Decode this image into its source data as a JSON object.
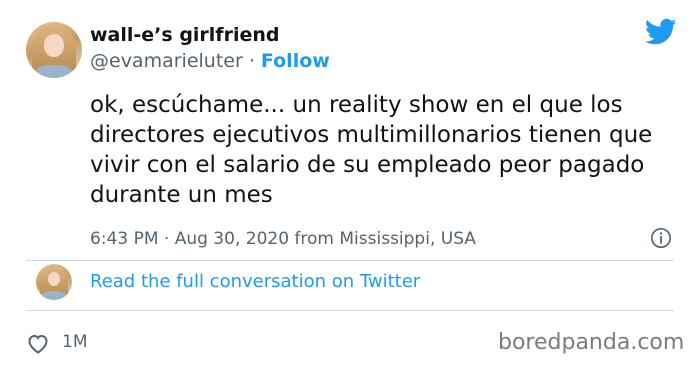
{
  "author": {
    "display_name": "wall-e’s girlfriend",
    "handle": "@evamarieluter",
    "separator": "·",
    "follow_label": "Follow"
  },
  "tweet": {
    "text": "ok, escúchame... un reality show en el que los directores ejecutivos multimillonarios tienen que vivir con el salario de su empleado peor pagado durante un mes",
    "meta": "6:43 PM · Aug 30, 2020 from Mississippi, USA"
  },
  "conversation": {
    "link_label": "Read the full conversation on Twitter"
  },
  "engagement": {
    "likes": "1M"
  },
  "watermark": "boredpanda.com",
  "icons": {
    "brand": "twitter-bird-icon",
    "info": "info-icon",
    "like": "heart-icon"
  },
  "colors": {
    "accent": "#1d9bf0",
    "text": "#0f1419",
    "secondary": "#536471"
  }
}
